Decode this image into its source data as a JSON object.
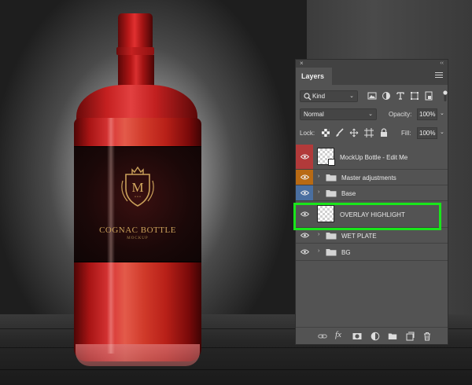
{
  "scene": {
    "label_title": "COGNAC BOTTLE",
    "label_subtitle": "MOCKUP",
    "crest_letter": "M",
    "crest_dots": "• • •"
  },
  "panel": {
    "close_glyph": "×",
    "collapse_glyph": "‹‹",
    "tab_label": "Layers",
    "filter": {
      "kind_icon": "search-icon",
      "kind_label": "Kind",
      "chevron": "⌄",
      "icons": [
        "image-filter-icon",
        "adjustment-filter-icon",
        "type-filter-icon",
        "shape-filter-icon",
        "smart-object-filter-icon"
      ]
    },
    "blend_mode": "Normal",
    "opacity_label": "Opacity:",
    "opacity_value": "100%",
    "lock_label": "Lock:",
    "fill_label": "Fill:",
    "fill_value": "100%",
    "layers": [
      {
        "name": "MockUp Bottle - Edit Me",
        "type": "smart-object",
        "eye_color": "#b23a3a",
        "visible": true
      },
      {
        "name": "Master adjustments",
        "type": "group",
        "eye_color": "#b86a14",
        "visible": true
      },
      {
        "name": "Base",
        "type": "group",
        "eye_color": "#4a6fa0",
        "visible": true
      },
      {
        "name": "OVERLAY HIGHLIGHT",
        "type": "pixel",
        "eye_color": "#535353",
        "visible": true,
        "highlighted": true
      },
      {
        "name": "WET PLATE",
        "type": "group",
        "eye_color": "#535353",
        "visible": true
      },
      {
        "name": "BG",
        "type": "group",
        "eye_color": "#535353",
        "visible": true
      }
    ],
    "bottom_icons": [
      "link-layers-icon",
      "fx-icon",
      "add-mask-icon",
      "adjustment-layer-icon",
      "new-group-icon",
      "new-layer-icon",
      "delete-layer-icon"
    ],
    "fx_label": "fx",
    "highlight_color": "#19e51a"
  }
}
